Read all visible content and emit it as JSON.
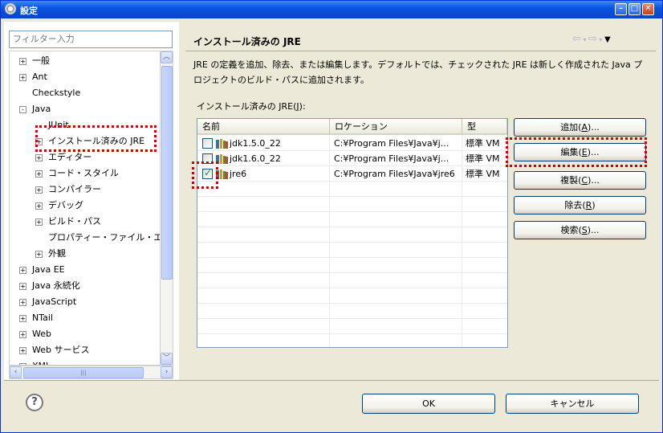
{
  "window": {
    "title": "設定"
  },
  "filter": {
    "placeholder": "フィルター入力"
  },
  "tree": {
    "items": [
      {
        "label": "一般",
        "expander": "+"
      },
      {
        "label": "Ant",
        "expander": "+"
      },
      {
        "label": "Checkstyle",
        "expander": ""
      },
      {
        "label": "Java",
        "expander": "-"
      },
      {
        "label": "JUnit",
        "expander": ""
      },
      {
        "label": "インストール済みの JRE",
        "expander": "+"
      },
      {
        "label": "エディター",
        "expander": "+"
      },
      {
        "label": "コード・スタイル",
        "expander": "+"
      },
      {
        "label": "コンパイラー",
        "expander": "+"
      },
      {
        "label": "デバッグ",
        "expander": "+"
      },
      {
        "label": "ビルド・パス",
        "expander": "+"
      },
      {
        "label": "プロパティー・ファイル・エ",
        "expander": ""
      },
      {
        "label": "外観",
        "expander": "+"
      },
      {
        "label": "Java EE",
        "expander": "+"
      },
      {
        "label": "Java 永続化",
        "expander": "+"
      },
      {
        "label": "JavaScript",
        "expander": "+"
      },
      {
        "label": "NTail",
        "expander": "+"
      },
      {
        "label": "Web",
        "expander": "+"
      },
      {
        "label": "Web サービス",
        "expander": "+"
      },
      {
        "label": "XML",
        "expander": "+"
      }
    ]
  },
  "page": {
    "title": "インストール済みの JRE",
    "description": "JRE の定義を追加、除去、または編集します。デフォルトでは、チェックされた JRE は新しく作成された Java プロジェクトのビルド・パスに追加されます。",
    "jre_label_prefix": "インストール済みの JRE(",
    "jre_label_key": "J",
    "jre_label_suffix": "):"
  },
  "table": {
    "headers": {
      "name": "名前",
      "location": "ロケーション",
      "type": "型"
    },
    "rows": [
      {
        "name": "jdk1.5.0_22",
        "location": "C:¥Program Files¥Java¥j...",
        "type": "標準 VM",
        "checked": false
      },
      {
        "name": "jdk1.6.0_22",
        "location": "C:¥Program Files¥Java¥j...",
        "type": "標準 VM",
        "checked": false
      },
      {
        "name": "jre6",
        "location": "C:¥Program Files¥Java¥jre6",
        "type": "標準 VM",
        "checked": true
      }
    ]
  },
  "buttons": {
    "add": {
      "label": "追加(",
      "key": "A",
      "suffix": ")..."
    },
    "edit": {
      "label": "編集(",
      "key": "E",
      "suffix": ")..."
    },
    "copy": {
      "label": "複製(",
      "key": "C",
      "suffix": ")..."
    },
    "remove": {
      "label": "除去(",
      "key": "R",
      "suffix": ")"
    },
    "search": {
      "label": "検索(",
      "key": "S",
      "suffix": ")..."
    },
    "ok": "OK",
    "cancel": "キャンセル"
  },
  "colors": {
    "highlight": "#d20000",
    "titlebar": "#0a54e0"
  }
}
